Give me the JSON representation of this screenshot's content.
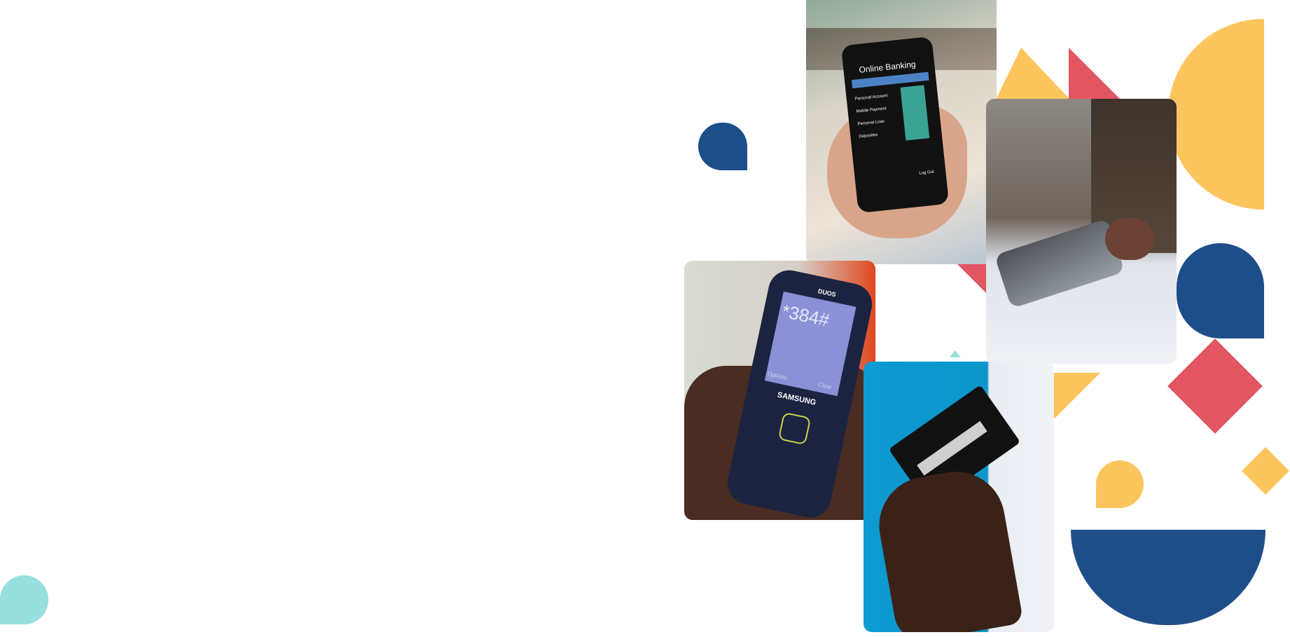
{
  "colors": {
    "blue": "#1e4e8a",
    "yellow": "#fdc55e",
    "red": "#e25563",
    "teal": "#98dfdf"
  },
  "photos": {
    "online_banking": {
      "screen_title": "Online Banking",
      "items": [
        "Personal Account",
        "Mobile Payment",
        "Personal Loan",
        "Deposites"
      ],
      "logout": "Log Out"
    },
    "feature_phone": {
      "dialed": "*384#",
      "brand": "SAMSUNG",
      "dual": "DUOS",
      "left_soft": "Options",
      "right_soft": "Clear"
    },
    "pos_terminal": {},
    "card_in_hand": {}
  }
}
